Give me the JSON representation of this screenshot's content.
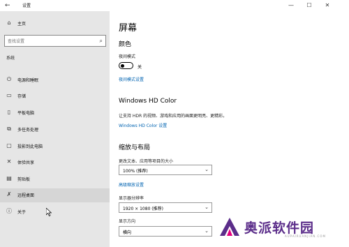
{
  "window": {
    "title": "设置"
  },
  "sidebar": {
    "home_label": "主页",
    "search_placeholder": "查找设置",
    "section_label": "系统",
    "items": [
      {
        "label": "电源和睡眠",
        "icon": "power-icon"
      },
      {
        "label": "存储",
        "icon": "storage-icon"
      },
      {
        "label": "平板电脑",
        "icon": "tablet-icon"
      },
      {
        "label": "多任务处理",
        "icon": "multitasking-icon"
      },
      {
        "label": "投影到此电脑",
        "icon": "projecting-icon"
      },
      {
        "label": "体验共享",
        "icon": "shared-experiences-icon"
      },
      {
        "label": "剪贴板",
        "icon": "clipboard-icon"
      },
      {
        "label": "远程桌面",
        "icon": "remote-desktop-icon"
      },
      {
        "label": "关于",
        "icon": "info-icon"
      }
    ]
  },
  "main": {
    "page_title": "屏幕",
    "color_heading": "颜色",
    "night_light_label": "夜间模式",
    "night_light_state": "关",
    "night_light_settings_link": "夜间模式设置",
    "hd_color_heading": "Windows HD Color",
    "hd_color_desc": "让支持 HDR 的视频、游戏和应用的画面更明亮、更精彩。",
    "hd_color_link": "Windows HD Color 设置",
    "scale_heading": "缩放与布局",
    "scale_label": "更改文本、应用等项目的大小",
    "scale_value": "100% (推荐)",
    "advanced_scaling_link": "高级缩放设置",
    "resolution_label": "显示器分辨率",
    "resolution_value": "1920 × 1080 (推荐)",
    "orientation_label": "显示方向",
    "orientation_value": "横向"
  },
  "watermark": {
    "text": "奥派软件园",
    "sub": "AUPAIRUANJIAN.COM"
  },
  "colors": {
    "accent": "#0063b1",
    "sidebar_bg": "#e6e6e6",
    "watermark": "#5b2d8a"
  }
}
